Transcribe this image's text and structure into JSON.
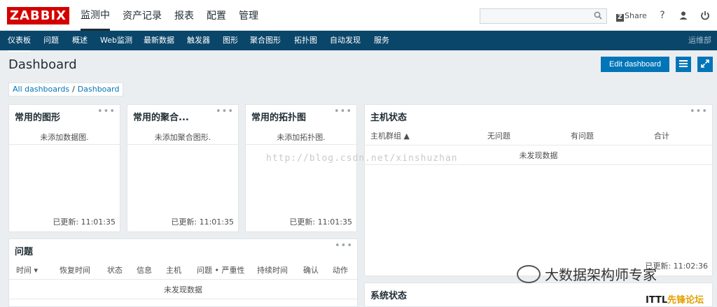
{
  "header": {
    "logo": "ZABBIX",
    "nav": [
      "监测中",
      "资产记录",
      "报表",
      "配置",
      "管理"
    ],
    "search_value": "",
    "share_mark": "Z",
    "share_label": "Share",
    "help_glyph": "?",
    "icons": [
      "search-icon",
      "share-icon",
      "help-icon",
      "user-icon",
      "power-icon"
    ]
  },
  "menu": {
    "items": [
      "仪表板",
      "问题",
      "概述",
      "Web监测",
      "最新数据",
      "触发器",
      "图形",
      "聚合图形",
      "拓扑图",
      "自动发现",
      "服务"
    ],
    "right": "运维部"
  },
  "page": {
    "title": "Dashboard",
    "edit_label": "Edit dashboard",
    "breadcrumb": [
      "All dashboards",
      "/",
      "Dashboard"
    ]
  },
  "widgets": {
    "fav_graphs": {
      "title": "常用的图形",
      "empty": "未添加数据图.",
      "updated": "已更新: 11:01:35"
    },
    "fav_screens": {
      "title": "常用的聚合...",
      "empty": "未添加聚合图形.",
      "updated": "已更新: 11:01:35"
    },
    "fav_maps": {
      "title": "常用的拓扑图",
      "empty": "未添加拓扑图.",
      "updated": "已更新: 11:01:35"
    },
    "host_status": {
      "title": "主机状态",
      "columns": [
        "主机群组 ▲",
        "无问题",
        "有问题",
        "合计"
      ],
      "empty": "未发现数据",
      "updated": "已更新: 11:02:36"
    },
    "problems": {
      "title": "问题",
      "columns": [
        "时间 ▾",
        "恢复时间",
        "状态",
        "信息",
        "主机",
        "问题 • 严重性",
        "持续时间",
        "确认",
        "动作"
      ],
      "empty": "未发现数据"
    },
    "system_status": {
      "title": "系统状态"
    }
  },
  "watermark": "http://blog.csdn.net/xinshuzhan",
  "overlay_brand": "大数据架构师专家",
  "overlay_forum": {
    "prefix": "ITTL",
    "rest": "先锋论坛"
  }
}
